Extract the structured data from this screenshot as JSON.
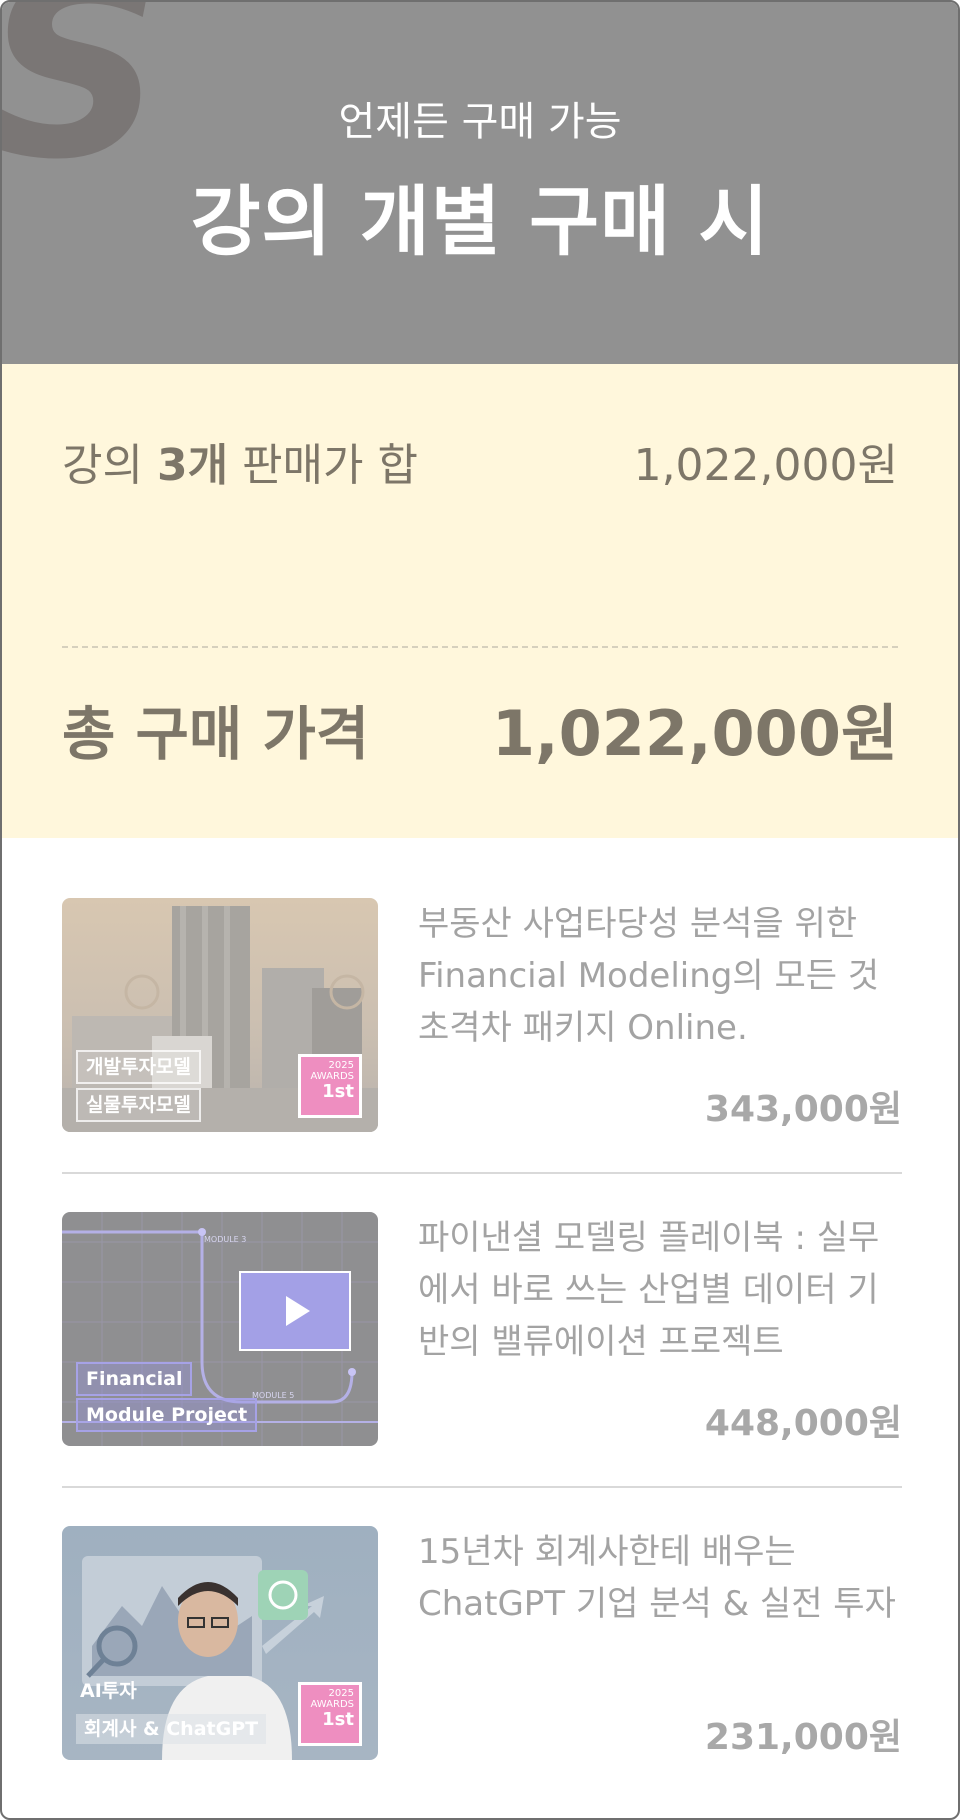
{
  "header": {
    "brand_letter": "S",
    "subtitle": "언제든 구매 가능",
    "title": "강의 개별 구매 시"
  },
  "summary": {
    "sum_label_prefix": "강의 ",
    "sum_label_count": "3개",
    "sum_label_suffix": " 판매가 합",
    "sum_value": "1,022,000원",
    "total_label": "총 구매 가격",
    "total_value": "1,022,000원"
  },
  "courses": [
    {
      "title": "부동산 사업타당성 분석을 위한 Financial Modeling의 모든 것 초격차 패키지 Online.",
      "price": "343,000원",
      "tags": [
        "개발투자모델",
        "실물투자모델"
      ],
      "award": {
        "year": "2025",
        "label": "AWARDS",
        "rank": "1st"
      }
    },
    {
      "title": "파이낸셜 모델링 플레이북 : 실무에서 바로 쓰는 산업별 데이터 기반의 밸류에이션 프로젝트",
      "price": "448,000원",
      "tags": [
        "Financial",
        "Module Project"
      ],
      "module_labels": [
        "MODULE 3",
        "MODULE 5"
      ]
    },
    {
      "title": "15년차 회계사한테 배우는 ChatGPT 기업 분석 & 실전 투자",
      "price": "231,000원",
      "tags": [
        "AI투자",
        "회계사 & ChatGPT"
      ],
      "award": {
        "year": "2025",
        "label": "AWARDS",
        "rank": "1st"
      }
    }
  ],
  "colors": {
    "header_bg": "#919191",
    "summary_bg": "#fff7dc",
    "summary_text": "#7d7668",
    "muted_text": "#a3a3a3",
    "award_pink": "#ee8ec0"
  }
}
